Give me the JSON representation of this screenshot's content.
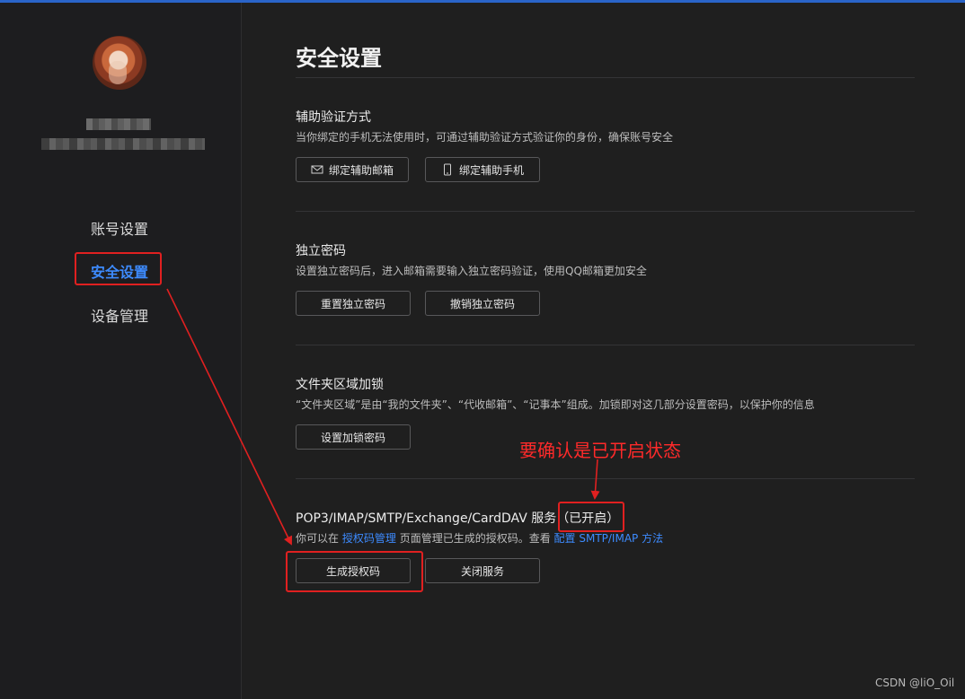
{
  "sidebar": {
    "nav": [
      {
        "label": "账号设置"
      },
      {
        "label": "安全设置"
      },
      {
        "label": "设备管理"
      }
    ]
  },
  "main": {
    "title": "安全设置",
    "sections": [
      {
        "title": "辅助验证方式",
        "desc": "当你绑定的手机无法使用时，可通过辅助验证方式验证你的身份，确保账号安全",
        "buttons": [
          "绑定辅助邮箱",
          "绑定辅助手机"
        ]
      },
      {
        "title": "独立密码",
        "desc": "设置独立密码后，进入邮箱需要输入独立密码验证，使用QQ邮箱更加安全",
        "buttons": [
          "重置独立密码",
          "撤销独立密码"
        ]
      },
      {
        "title": "文件夹区域加锁",
        "desc": "“文件夹区域”是由“我的文件夹”、“代收邮箱”、“记事本”组成。加锁即对这几部分设置密码，以保护你的信息",
        "buttons": [
          "设置加锁密码"
        ]
      },
      {
        "title": "POP3/IMAP/SMTP/Exchange/CardDAV 服务",
        "status": "（已开启）",
        "desc_prefix": "你可以在",
        "desc_link1": "授权码管理",
        "desc_middle": "页面管理已生成的授权码。查看",
        "desc_link2": "配置 SMTP/IMAP 方法",
        "buttons": [
          "生成授权码",
          "关闭服务"
        ]
      }
    ]
  },
  "annotation": {
    "note": "要确认是已开启状态"
  },
  "watermark": "CSDN @liO_Oil",
  "colors": {
    "accent": "#3d8bff",
    "annotation": "#e02020",
    "background": "#1f1f1f"
  }
}
